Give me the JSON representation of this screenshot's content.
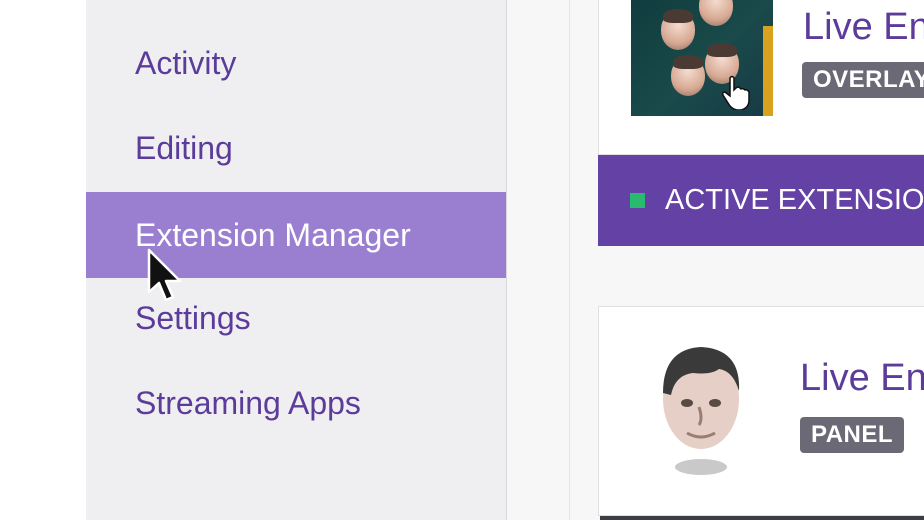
{
  "sidebar": {
    "items": [
      {
        "label": "Activity",
        "active": false
      },
      {
        "label": "Editing",
        "active": false
      },
      {
        "label": "Extension Manager",
        "active": true
      },
      {
        "label": "Settings",
        "active": false
      },
      {
        "label": "Streaming Apps",
        "active": false
      }
    ]
  },
  "extensions": [
    {
      "title": "Live En",
      "badge": "OVERLAY",
      "icon": "kappa-faces-thumbnail"
    },
    {
      "title": "Live En",
      "badge": "PANEL",
      "icon": "kappa-face-avatar"
    }
  ],
  "active_section": {
    "label": "ACTIVE EXTENSIO",
    "status_color": "#2ab971"
  },
  "colors": {
    "brand": "#6441a4",
    "nav_text": "#5c3c9a",
    "nav_active_bg": "#9a7fd1",
    "badge_bg": "#6b6975"
  }
}
